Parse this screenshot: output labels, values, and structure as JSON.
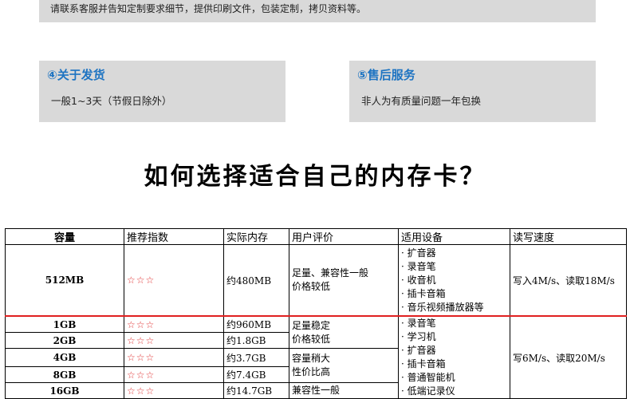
{
  "top_note": "请联系客服并告知定制要求细节，提供印刷文件，包装定制，拷贝资料等。",
  "shipping": {
    "title": "④关于发货",
    "desc": "一般1~3天（节假日除外）"
  },
  "after_sales": {
    "title": "⑤售后服务",
    "desc": "非人为有质量问题一年包换"
  },
  "headline": "如何选择适合自己的内存卡？",
  "table": {
    "headers": [
      "容量",
      "推荐指数",
      "实际内存",
      "用户评价",
      "适用设备",
      "读写速度"
    ],
    "colors": {
      "stars": "#e03030",
      "separator": "#e02020",
      "accent": "#1e74c2"
    },
    "row_512": {
      "capacity": "512MB",
      "stars": "☆☆☆",
      "actual": "约480MB",
      "review_1": "足量、兼容性一般",
      "review_2": "价格较低",
      "devices": [
        "· 扩音器",
        "· 录音笔",
        "· 收音机",
        "· 插卡音箱",
        "· 音乐视频播放器等"
      ],
      "speed": "写入4M/s、读取18M/s"
    },
    "group": {
      "rows": [
        {
          "capacity": "1GB",
          "stars": "☆☆☆",
          "actual": "约960MB"
        },
        {
          "capacity": "2GB",
          "stars": "☆☆☆",
          "actual": "约1.8GB"
        },
        {
          "capacity": "4GB",
          "stars": "☆☆☆",
          "actual": "约3.7GB"
        },
        {
          "capacity": "8GB",
          "stars": "☆☆☆",
          "actual": "约7.4GB"
        },
        {
          "capacity": "16GB",
          "stars": "☆☆☆",
          "actual": "约14.7GB"
        }
      ],
      "review_a_1": "足量稳定",
      "review_a_2": "价格较低",
      "review_b_1": "容量稍大",
      "review_b_2": "性价比高",
      "review_c_1": "兼容性一般",
      "devices": [
        "· 录音笔",
        "· 学习机",
        "· 扩音器",
        "· 插卡音箱",
        "· 普通智能机",
        "· 低端记录仪"
      ],
      "speed": "写6M/s、读取20M/s"
    }
  }
}
